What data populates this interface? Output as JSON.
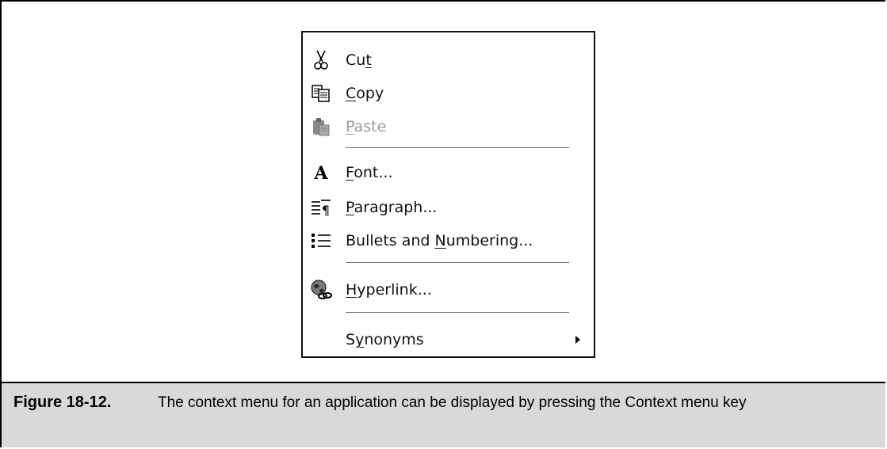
{
  "menu": {
    "items": [
      {
        "icon": "scissors-icon",
        "pre": "Cu",
        "key": "t",
        "post": "",
        "enabled": true
      },
      {
        "icon": "copy-icon",
        "pre": "",
        "key": "C",
        "post": "opy",
        "enabled": true
      },
      {
        "icon": "paste-icon",
        "pre": "",
        "key": "P",
        "post": "aste",
        "enabled": false
      },
      {
        "icon": "font-icon",
        "pre": "",
        "key": "F",
        "post": "ont...",
        "enabled": true
      },
      {
        "icon": "paragraph-icon",
        "pre": "",
        "key": "P",
        "post": "aragraph...",
        "enabled": true
      },
      {
        "icon": "bullets-icon",
        "pre": "Bullets and ",
        "key": "N",
        "post": "umbering...",
        "enabled": true
      },
      {
        "icon": "hyperlink-globe-icon",
        "pre": "",
        "key": "H",
        "post": "yperlink...",
        "enabled": true
      },
      {
        "icon": "",
        "pre": "S",
        "key": "y",
        "post": "nonyms",
        "enabled": true,
        "submenu": true
      }
    ]
  },
  "caption": {
    "figure": "Figure 18-12.",
    "text": "The context menu for an application can be displayed by pressing the Context menu key"
  }
}
